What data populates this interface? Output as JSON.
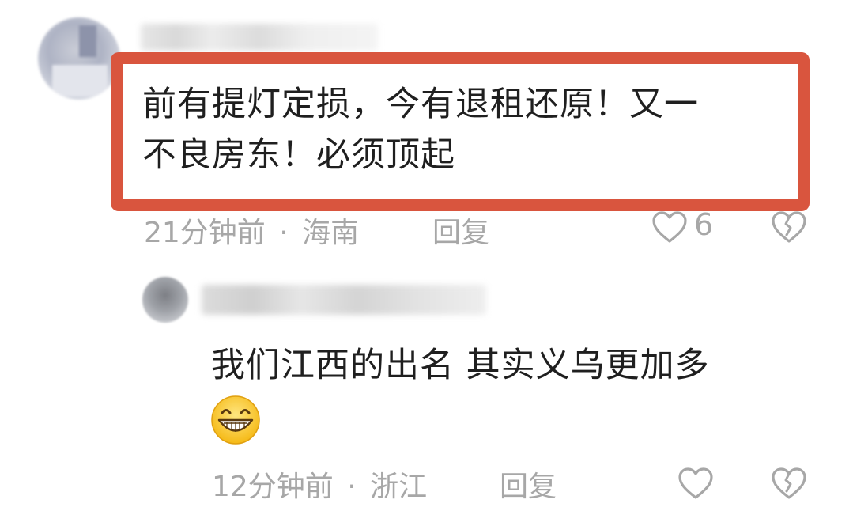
{
  "comments": [
    {
      "text_line1": "前有提灯定损，今有退租还原！又一",
      "text_line2": "不良房东！必须顶起",
      "time": "21分钟前",
      "separator": "·",
      "location": "海南",
      "reply_label": "回复",
      "like_count": "6",
      "highlighted": true,
      "highlight_color": "#d9553e"
    },
    {
      "text": "我们江西的出名 其实义乌更加多",
      "emoji": "grinning-face",
      "time": "12分钟前",
      "separator": "·",
      "location": "浙江",
      "reply_label": "回复"
    }
  ],
  "colors": {
    "text": "#1f1f1f",
    "meta": "#a7a7a7",
    "highlight": "#d9553e"
  },
  "icons": [
    "heart-icon",
    "broken-heart-icon",
    "grinning-face-emoji"
  ]
}
